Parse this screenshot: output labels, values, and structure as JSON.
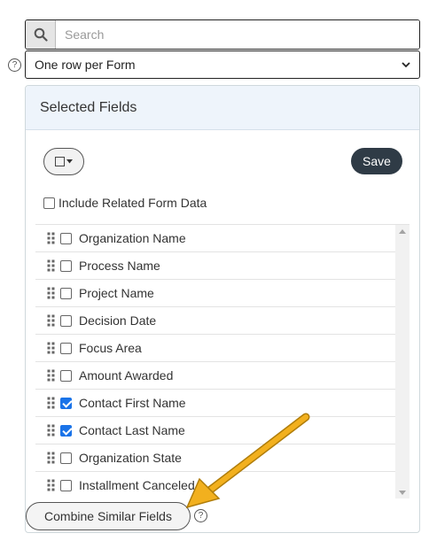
{
  "search": {
    "placeholder": "Search",
    "icon": "search-icon"
  },
  "mode_select": {
    "selected": "One row per Form"
  },
  "panel": {
    "title": "Selected Fields",
    "save_label": "Save",
    "include_related_label": "Include Related Form Data",
    "combine_label": "Combine Similar Fields",
    "fields": [
      {
        "label": "Organization Name",
        "checked": false
      },
      {
        "label": "Process Name",
        "checked": false
      },
      {
        "label": "Project Name",
        "checked": false
      },
      {
        "label": "Decision Date",
        "checked": false
      },
      {
        "label": "Focus Area",
        "checked": false
      },
      {
        "label": "Amount Awarded",
        "checked": false
      },
      {
        "label": "Contact First Name",
        "checked": true
      },
      {
        "label": "Contact Last Name",
        "checked": true
      },
      {
        "label": "Organization State",
        "checked": false
      },
      {
        "label": "Installment Canceled",
        "checked": false
      }
    ]
  },
  "help_icon_glyph": "?",
  "colors": {
    "accent": "#1a73e8",
    "save_bg": "#2f3b46",
    "header_bg": "#eef4fb",
    "arrow": "#f2b01e"
  }
}
